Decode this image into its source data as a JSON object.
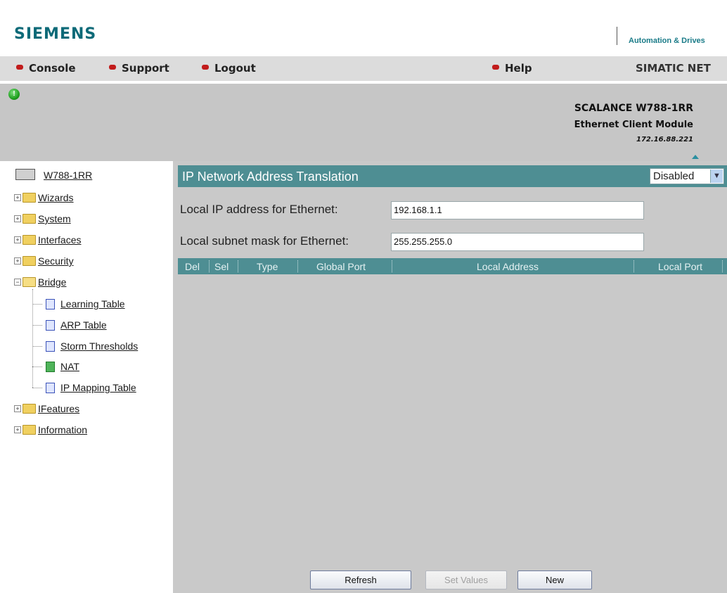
{
  "header": {
    "logo": "SIEMENS",
    "tagline": "Automation & Drives"
  },
  "menubar": {
    "items": [
      {
        "label": "Console"
      },
      {
        "label": "Support"
      },
      {
        "label": "Logout"
      },
      {
        "label": "Help"
      }
    ],
    "brand": "SIMATIC NET"
  },
  "product": {
    "status_led": "!",
    "name": "SCALANCE W788-1RR",
    "subtitle": "Ethernet Client Module",
    "ip": "172.16.88.221"
  },
  "sidebar": {
    "device": "W788-1RR",
    "items": [
      {
        "label": "Wizards",
        "type": "folder",
        "expanded": false
      },
      {
        "label": "System",
        "type": "folder",
        "expanded": false
      },
      {
        "label": "Interfaces",
        "type": "folder",
        "expanded": false
      },
      {
        "label": "Security",
        "type": "folder",
        "expanded": false
      },
      {
        "label": "Bridge",
        "type": "folder",
        "expanded": true
      },
      {
        "label": "Learning Table",
        "type": "page"
      },
      {
        "label": "ARP Table",
        "type": "page"
      },
      {
        "label": "Storm Thresholds",
        "type": "page"
      },
      {
        "label": "NAT",
        "type": "page",
        "active": true
      },
      {
        "label": "IP Mapping Table",
        "type": "page"
      },
      {
        "label": "IFeatures",
        "type": "folder",
        "expanded": false
      },
      {
        "label": "Information",
        "type": "folder",
        "expanded": false
      }
    ]
  },
  "main": {
    "title": "IP Network Address Translation",
    "mode": {
      "selected": "Disabled"
    },
    "fields": [
      {
        "label": "Local IP address for Ethernet:",
        "value": "192.168.1.1"
      },
      {
        "label": "Local subnet mask for Ethernet:",
        "value": "255.255.255.0"
      }
    ],
    "table": {
      "columns": [
        "Del",
        "Sel",
        "Type",
        "Global Port",
        "Local Address",
        "Local Port"
      ],
      "rows": []
    },
    "buttons": {
      "refresh": "Refresh",
      "set_values": "Set Values",
      "new": "New"
    }
  },
  "colors": {
    "accent": "#4e8e93",
    "brand": "#0d6a78",
    "bullet": "#c21c1c",
    "status_ok": "#1fa01f"
  }
}
